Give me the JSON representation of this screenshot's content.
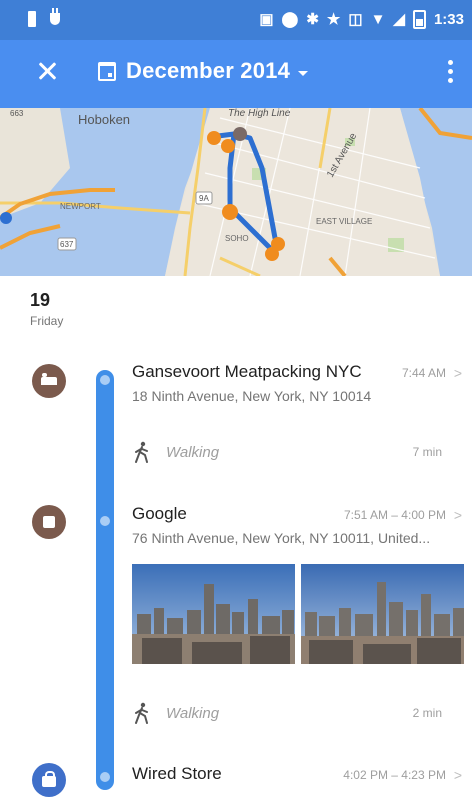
{
  "status_bar": {
    "time": "1:33",
    "icons": [
      "sim-card-icon",
      "charging-icon",
      "cast-icon",
      "location-pin-icon",
      "bluetooth-icon",
      "star-icon",
      "vibrate-icon",
      "wifi-icon",
      "cell-signal-icon",
      "battery-icon"
    ]
  },
  "toolbar": {
    "close_icon": "close-icon",
    "calendar_icon": "calendar-icon",
    "date_title": "December 2014",
    "more_icon": "more-vert-icon",
    "accent": "#4a8ef0"
  },
  "map": {
    "labels": {
      "hoboken": "Hoboken",
      "high_line": "The High Line",
      "first_avenue": "1st Avenue",
      "newport": "NEWPORT",
      "east_village": "EAST VILLAGE",
      "soho": "SOHO",
      "shield_9a": "9A",
      "shield_637": "637",
      "shield_663": "663"
    }
  },
  "day": {
    "number": "19",
    "weekday": "Friday"
  },
  "timeline": {
    "track_color": "#3f8ee8",
    "places": [
      {
        "name": "Gansevoort Meatpacking NYC",
        "time": "7:44 AM",
        "address": "18 Ninth Avenue, New York, NY 10014",
        "icon": "hotel-icon"
      },
      {
        "name": "Google",
        "time": "7:51 AM – 4:00 PM",
        "address": "76 Ninth Avenue, New York, NY 10011, United...",
        "icon": "place-icon"
      },
      {
        "name": "Wired Store",
        "time": "4:02 PM – 4:23 PM",
        "icon": "shopping-icon"
      }
    ],
    "walks": [
      {
        "label": "Walking",
        "duration": "7 min",
        "icon": "walking-icon"
      },
      {
        "label": "Walking",
        "duration": "2 min",
        "icon": "walking-icon"
      }
    ],
    "chevron": ">"
  }
}
